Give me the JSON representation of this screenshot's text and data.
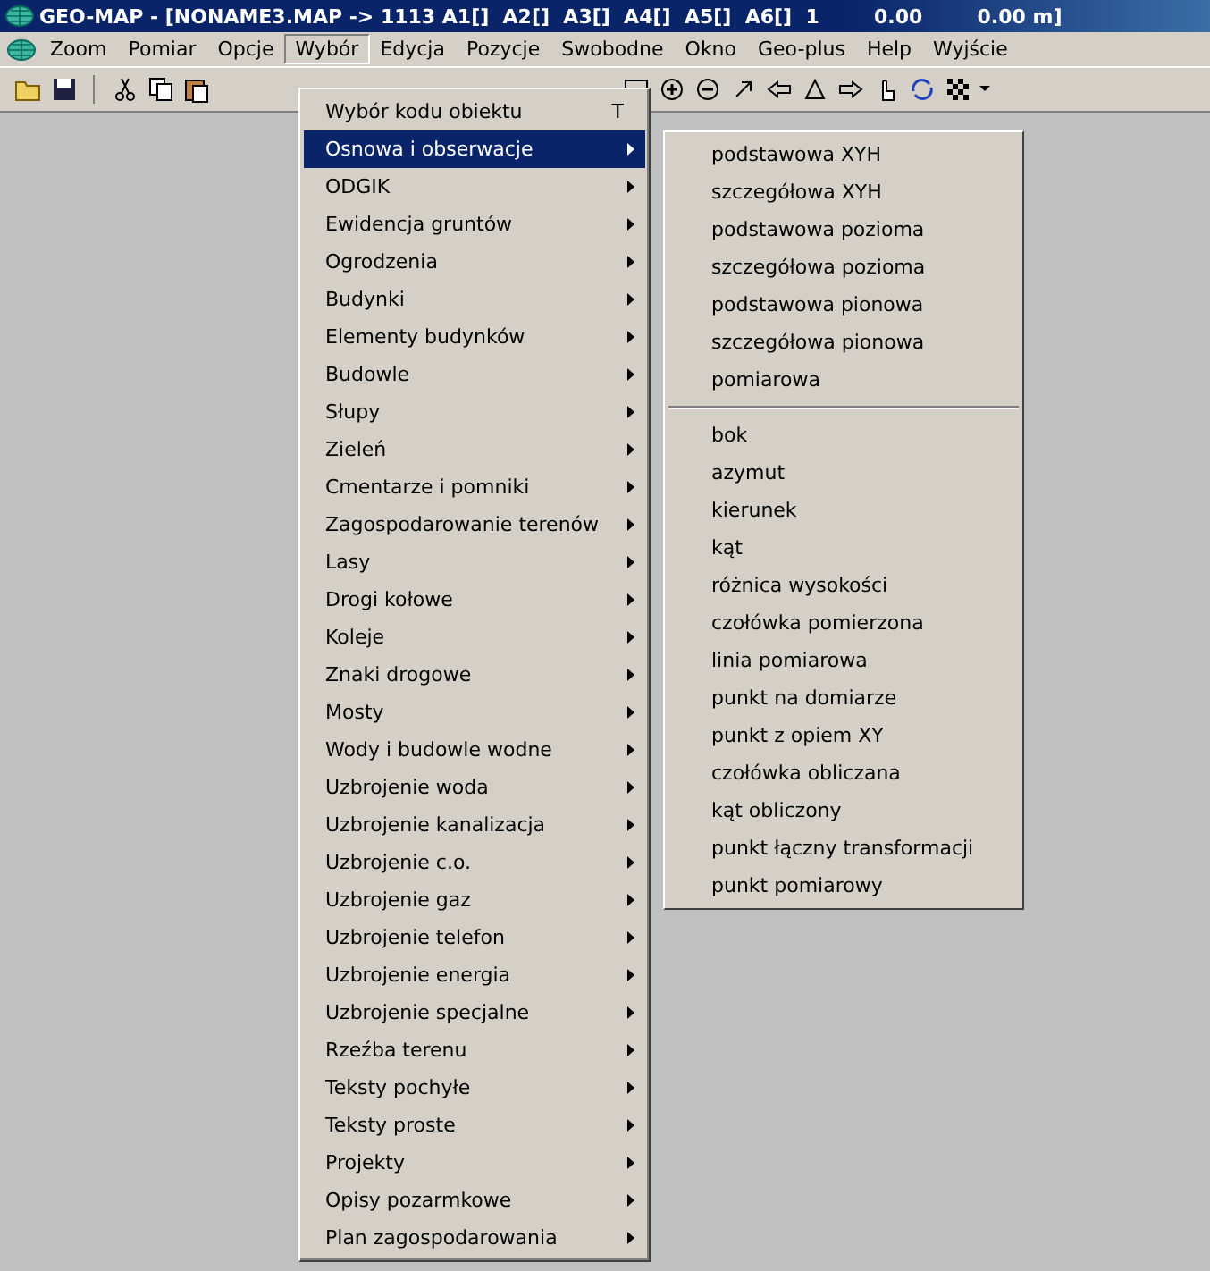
{
  "window": {
    "title": "GEO-MAP - [NONAME3.MAP -> 1113 A1[]  A2[]  A3[]  A4[]  A5[]  A6[]  1        0.00        0.00 m]"
  },
  "menubar": [
    {
      "label": "Zoom",
      "selected": false
    },
    {
      "label": "Pomiar",
      "selected": false
    },
    {
      "label": "Opcje",
      "selected": false
    },
    {
      "label": "Wybór",
      "selected": true
    },
    {
      "label": "Edycja",
      "selected": false
    },
    {
      "label": "Pozycje",
      "selected": false
    },
    {
      "label": "Swobodne",
      "selected": false
    },
    {
      "label": "Okno",
      "selected": false
    },
    {
      "label": "Geo-plus",
      "selected": false
    },
    {
      "label": "Help",
      "selected": false
    },
    {
      "label": "Wyjście",
      "selected": false
    }
  ],
  "menu": [
    {
      "label": "Wybór kodu obiektu",
      "shortcut": "T",
      "submenu": false,
      "selected": false
    },
    {
      "label": "Osnowa i obserwacje",
      "submenu": true,
      "selected": true
    },
    {
      "label": "ODGIK",
      "submenu": true,
      "selected": false
    },
    {
      "label": "Ewidencja gruntów",
      "submenu": true,
      "selected": false
    },
    {
      "label": "Ogrodzenia",
      "submenu": true,
      "selected": false
    },
    {
      "label": "Budynki",
      "submenu": true,
      "selected": false
    },
    {
      "label": "Elementy budynków",
      "submenu": true,
      "selected": false
    },
    {
      "label": "Budowle",
      "submenu": true,
      "selected": false
    },
    {
      "label": "Słupy",
      "submenu": true,
      "selected": false
    },
    {
      "label": "Zieleń",
      "submenu": true,
      "selected": false
    },
    {
      "label": "Cmentarze i pomniki",
      "submenu": true,
      "selected": false
    },
    {
      "label": "Zagospodarowanie terenów",
      "submenu": true,
      "selected": false
    },
    {
      "label": "Lasy",
      "submenu": true,
      "selected": false
    },
    {
      "label": "Drogi kołowe",
      "submenu": true,
      "selected": false
    },
    {
      "label": "Koleje",
      "submenu": true,
      "selected": false
    },
    {
      "label": "Znaki drogowe",
      "submenu": true,
      "selected": false
    },
    {
      "label": "Mosty",
      "submenu": true,
      "selected": false
    },
    {
      "label": "Wody i budowle wodne",
      "submenu": true,
      "selected": false
    },
    {
      "label": "Uzbrojenie woda",
      "submenu": true,
      "selected": false
    },
    {
      "label": "Uzbrojenie kanalizacja",
      "submenu": true,
      "selected": false
    },
    {
      "label": "Uzbrojenie c.o.",
      "submenu": true,
      "selected": false
    },
    {
      "label": "Uzbrojenie gaz",
      "submenu": true,
      "selected": false
    },
    {
      "label": "Uzbrojenie telefon",
      "submenu": true,
      "selected": false
    },
    {
      "label": "Uzbrojenie energia",
      "submenu": true,
      "selected": false
    },
    {
      "label": "Uzbrojenie specjalne",
      "submenu": true,
      "selected": false
    },
    {
      "label": "Rzeźba terenu",
      "submenu": true,
      "selected": false
    },
    {
      "label": "Teksty pochyłe",
      "submenu": true,
      "selected": false
    },
    {
      "label": "Teksty proste",
      "submenu": true,
      "selected": false
    },
    {
      "label": "Projekty",
      "submenu": true,
      "selected": false
    },
    {
      "label": "Opisy pozarmkowe",
      "submenu": true,
      "selected": false
    },
    {
      "label": "Plan zagospodarowania",
      "submenu": true,
      "selected": false
    }
  ],
  "submenu": {
    "groups": [
      [
        "podstawowa XYH",
        "szczegółowa XYH",
        "podstawowa pozioma",
        "szczegółowa pozioma",
        "podstawowa pionowa",
        "szczegółowa pionowa",
        "pomiarowa"
      ],
      [
        "bok",
        "azymut",
        "kierunek",
        "kąt",
        "różnica wysokości",
        "czołówka pomierzona",
        "linia pomiarowa",
        "punkt na domiarze",
        "punkt z opiem XY",
        "czołówka obliczana",
        "kąt obliczony",
        "punkt łączny transformacji",
        "punkt pomiarowy"
      ]
    ]
  }
}
